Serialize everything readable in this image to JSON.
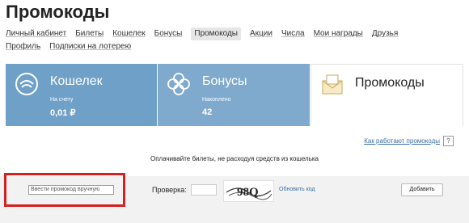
{
  "page": {
    "title": "Промокоды"
  },
  "nav": {
    "row1": [
      {
        "label": "Личный кабинет",
        "active": false
      },
      {
        "label": "Билеты",
        "active": false
      },
      {
        "label": "Кошелек",
        "active": false
      },
      {
        "label": "Бонусы",
        "active": false
      },
      {
        "label": "Промокоды",
        "active": true
      },
      {
        "label": "Акции",
        "active": false
      },
      {
        "label": "Числа",
        "active": false
      },
      {
        "label": "Мои награды",
        "active": false
      },
      {
        "label": "Друзья",
        "active": false
      }
    ],
    "row2": [
      {
        "label": "Профиль",
        "active": false
      },
      {
        "label": "Подписки на лотерею",
        "active": false
      }
    ]
  },
  "panels": {
    "wallet": {
      "title": "Кошелек",
      "label": "На счету",
      "value": "0,01 ₽",
      "icon": "wallet-icon"
    },
    "bonus": {
      "title": "Бонусы",
      "label": "Накоплено",
      "value": "42",
      "icon": "clover-icon"
    },
    "promo": {
      "title": "Промокоды",
      "icon": "envelope-icon"
    }
  },
  "info": {
    "how_link": "Как работают промокоды",
    "help_icon": "?",
    "pay_text": "Оплачивайте билеты, не расходуя средств из кошелька"
  },
  "form": {
    "code_placeholder": "Ввести промокод вручную",
    "check_label": "Проверка:",
    "captcha_text": "98Q",
    "refresh_label": "Обновить код",
    "add_label": "Добавить"
  },
  "colors": {
    "wallet": "#6ea0c8",
    "bonus": "#7faacd",
    "highlight": "#d32020"
  }
}
